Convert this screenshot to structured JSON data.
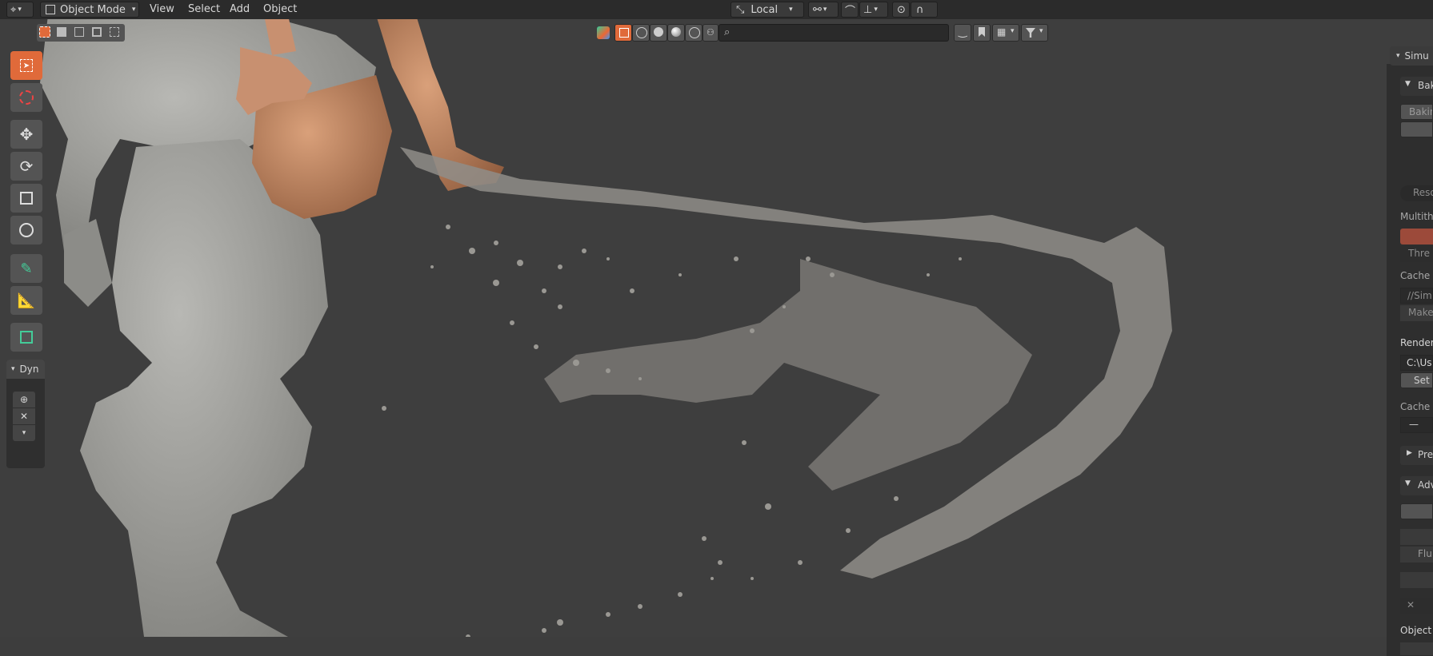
{
  "header": {
    "mode_label": "Object Mode",
    "menus": [
      "View",
      "Select",
      "Add",
      "Object"
    ],
    "orientation_label": "Local"
  },
  "tools": [
    "select-box",
    "cursor",
    "move",
    "rotate",
    "scale",
    "transform",
    "annotate",
    "measure",
    "add-cube"
  ],
  "dynamic_panel": {
    "label": "Dyn"
  },
  "viewport_header": {
    "search_placeholder": ""
  },
  "sidebar": {
    "tab": "Simu",
    "bake_section": "Bak",
    "baking_label": "Bakin",
    "reso_label": "Reso",
    "multith_label": "Multith",
    "three_label": "Thre",
    "cache_label": "Cache",
    "cache_path": "//Simu",
    "make_label": "Make",
    "render_label": "Render",
    "render_path": "C:\\Use",
    "set_label": "Set",
    "cache2_label": "Cache",
    "pre_section": "Pre",
    "adv_section": "Adv",
    "flu_label": "Flu",
    "object_label": "Object"
  },
  "colors": {
    "accent": "#e06a3a",
    "header_bg": "#2b2b2b",
    "viewport_bg": "#3e3e3e",
    "mesh": "#9a9a96",
    "skin": "#c48c68"
  }
}
